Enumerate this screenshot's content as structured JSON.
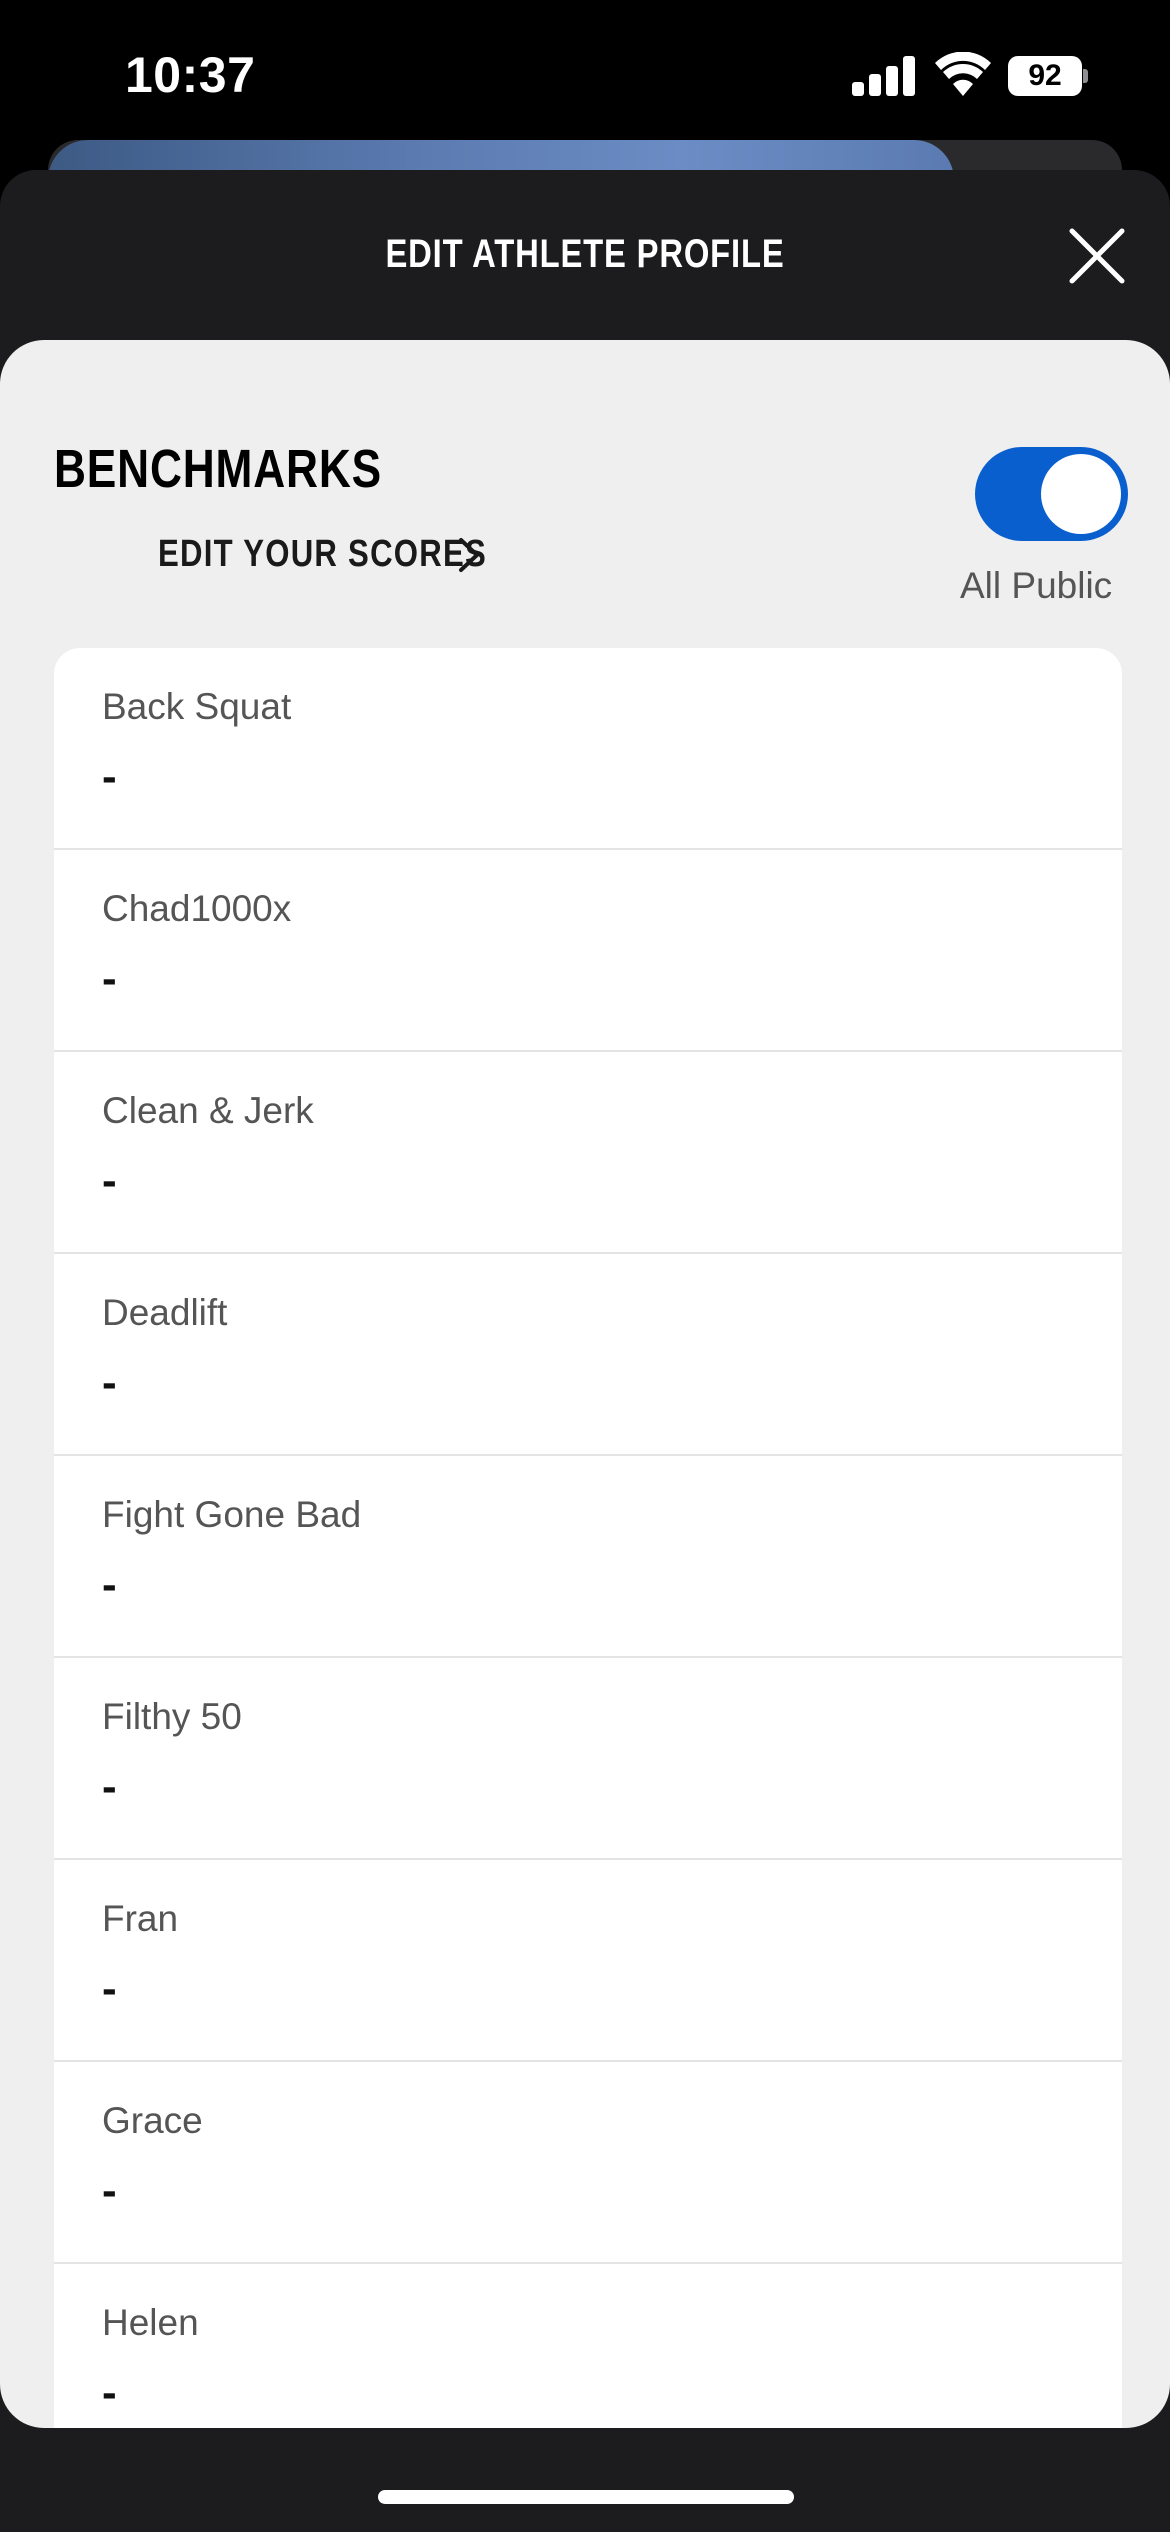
{
  "status_bar": {
    "time": "10:37",
    "battery": "92"
  },
  "sheet": {
    "title": "EDIT ATHLETE PROFILE"
  },
  "benchmarks": {
    "title": "BENCHMARKS",
    "edit_label": "EDIT YOUR SCORES",
    "visibility_toggle": true,
    "visibility_label": "All Public",
    "accent_color": "#0a5fcf"
  },
  "items": [
    {
      "name": "Back Squat",
      "value": "-"
    },
    {
      "name": "Chad1000x",
      "value": "-"
    },
    {
      "name": "Clean & Jerk",
      "value": "-"
    },
    {
      "name": "Deadlift",
      "value": "-"
    },
    {
      "name": "Fight Gone Bad",
      "value": "-"
    },
    {
      "name": "Filthy 50",
      "value": "-"
    },
    {
      "name": "Fran",
      "value": "-"
    },
    {
      "name": "Grace",
      "value": "-"
    },
    {
      "name": "Helen",
      "value": "-"
    }
  ],
  "icons": {
    "close": "close-icon",
    "chevron": "chevron-right-icon",
    "signal": "cellular-signal-icon",
    "wifi": "wifi-icon",
    "battery": "battery-icon"
  }
}
